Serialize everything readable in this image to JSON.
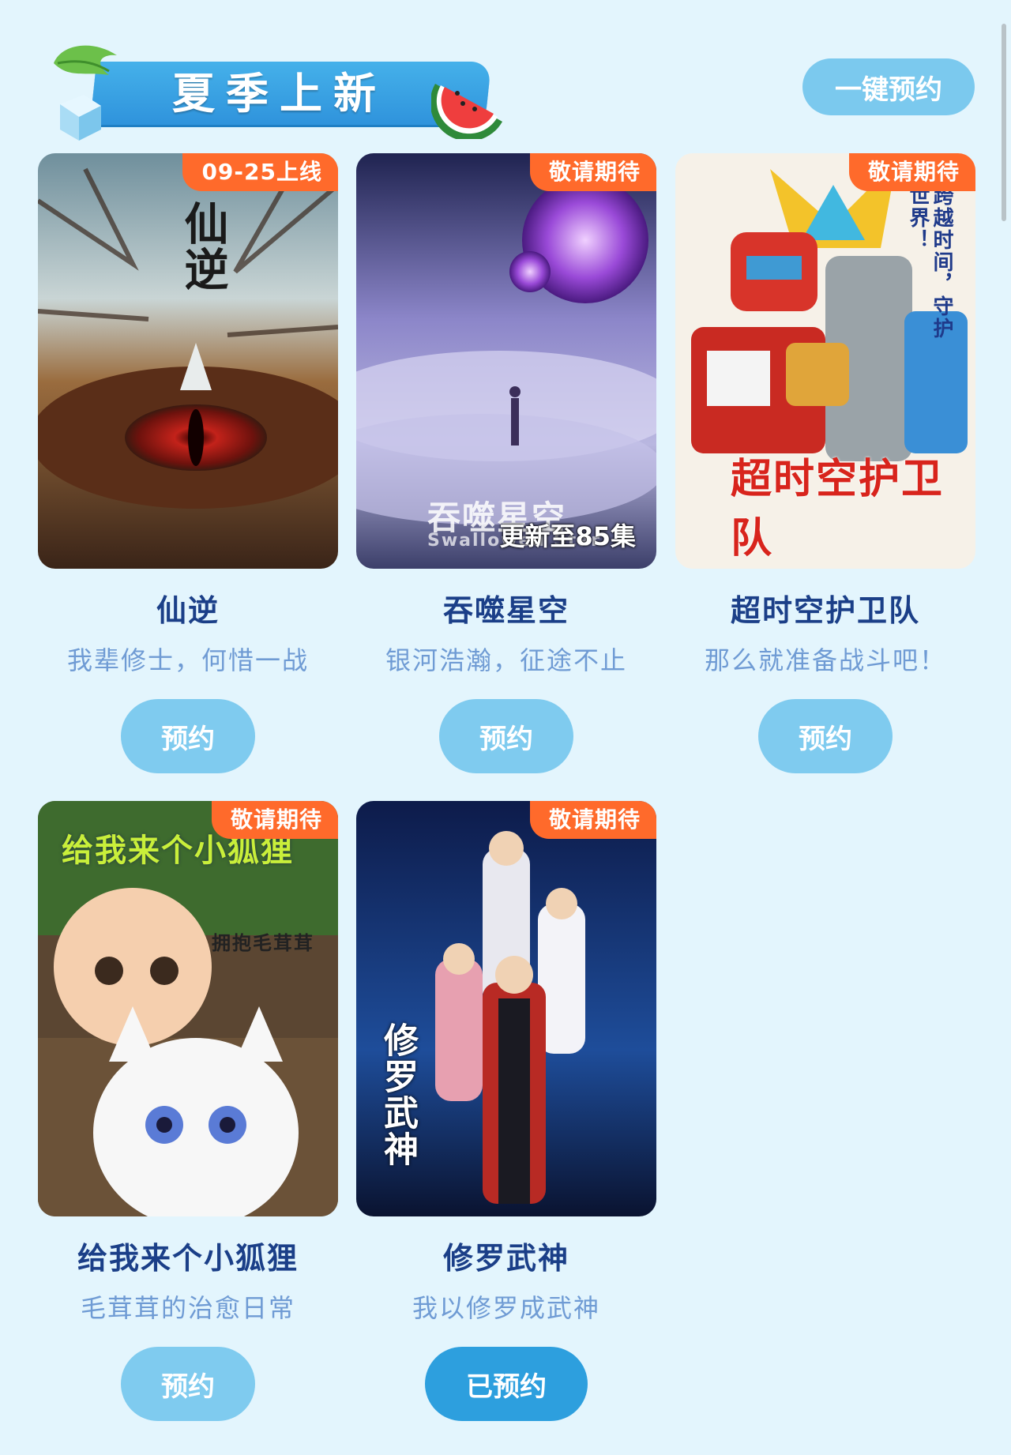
{
  "header": {
    "title": "夏季上新",
    "reserve_all_label": "一键预约"
  },
  "shows": [
    {
      "badge": "09-25上线",
      "poster_logo": "仙逆",
      "title": "仙逆",
      "subtitle": "我辈修士，何惜一战",
      "button": "预约"
    },
    {
      "badge": "敬请期待",
      "poster_logo": "吞噬星空",
      "poster_logo_en": "Swallowed Star",
      "episode_note": "更新至85集",
      "title": "吞噬星空",
      "subtitle": "银河浩瀚，征途不止",
      "button": "预约"
    },
    {
      "badge": "敬请期待",
      "poster_logo": "超时空护卫队",
      "poster_tagline": "跨越时间，守护世界！",
      "title": "超时空护卫队",
      "subtitle": "那么就准备战斗吧！",
      "button": "预约"
    },
    {
      "badge": "敬请期待",
      "poster_logo": "给我来个小狐狸",
      "poster_sub": "拥抱毛茸茸",
      "title": "给我来个小狐狸",
      "subtitle": "毛茸茸的治愈日常",
      "button": "预约"
    },
    {
      "badge": "敬请期待",
      "poster_logo": "修罗武神",
      "title": "修罗武神",
      "subtitle": "我以修罗成武神",
      "button": "已预约"
    }
  ],
  "colors": {
    "background": "#e3f5fd",
    "badge": "#ff6a2b",
    "button": "#7fcbef",
    "button_reserved": "#2d9fde",
    "title": "#1b3f88",
    "subtitle": "#6f9bd4"
  }
}
